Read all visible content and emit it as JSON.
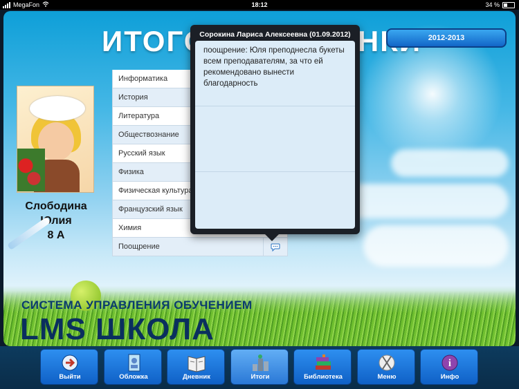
{
  "status_bar": {
    "carrier": "MegaFon",
    "time": "18:12",
    "battery": "34 %"
  },
  "header": {
    "title": "ИТОГОВЫЕ ОЦЕНКИ",
    "year_button": "2012-2013"
  },
  "student": {
    "first_line": "Слободина",
    "second_line": "Юлия",
    "class": "8 А"
  },
  "subjects": [
    {
      "label": "Информатика"
    },
    {
      "label": "История"
    },
    {
      "label": "Литература"
    },
    {
      "label": "Обществознание"
    },
    {
      "label": "Русский язык"
    },
    {
      "label": "Физика"
    },
    {
      "label": "Физическая культура"
    },
    {
      "label": "Французский язык"
    },
    {
      "label": "Химия"
    },
    {
      "label": "Поощрение"
    }
  ],
  "popover": {
    "title": "Сорокина Лариса Алексеевна (01.09.2012)",
    "text": "поощрение: Юля преподнесла букеты всем преподавателям, за что ей рекомендовано вынести благодарность"
  },
  "branding": {
    "subtitle": "СИСТЕМА УПРАВЛЕНИЯ ОБУЧЕНИЕМ",
    "title": "LMS ШКОЛА"
  },
  "dock": [
    {
      "label": "Выйти",
      "icon": "exit-icon"
    },
    {
      "label": "Обложка",
      "icon": "cover-icon"
    },
    {
      "label": "Дневник",
      "icon": "diary-icon"
    },
    {
      "label": "Итоги",
      "icon": "results-icon"
    },
    {
      "label": "Библиотека",
      "icon": "library-icon"
    },
    {
      "label": "Меню",
      "icon": "menu-icon"
    },
    {
      "label": "Инфо",
      "icon": "info-icon"
    }
  ]
}
